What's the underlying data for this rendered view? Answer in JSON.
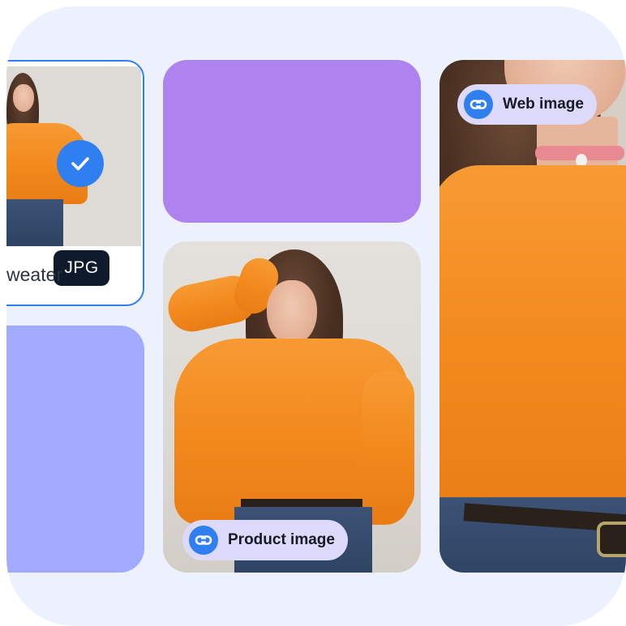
{
  "cards": {
    "selected": {
      "label": "weater",
      "format_badge": "JPG",
      "check_icon": "check-icon",
      "selected": true
    },
    "product": {
      "tag": "Product image",
      "tag_icon": "link-icon"
    },
    "web": {
      "tag": "Web image",
      "tag_icon": "link-icon"
    }
  },
  "colors": {
    "accent": "#2f7ff1",
    "tile_purple": "#ae82ef",
    "tile_lavender": "#a2aaff",
    "pill_bg": "#ddd9fb",
    "badge_dark": "#0f1a2c",
    "background": "#ecf1fd"
  }
}
